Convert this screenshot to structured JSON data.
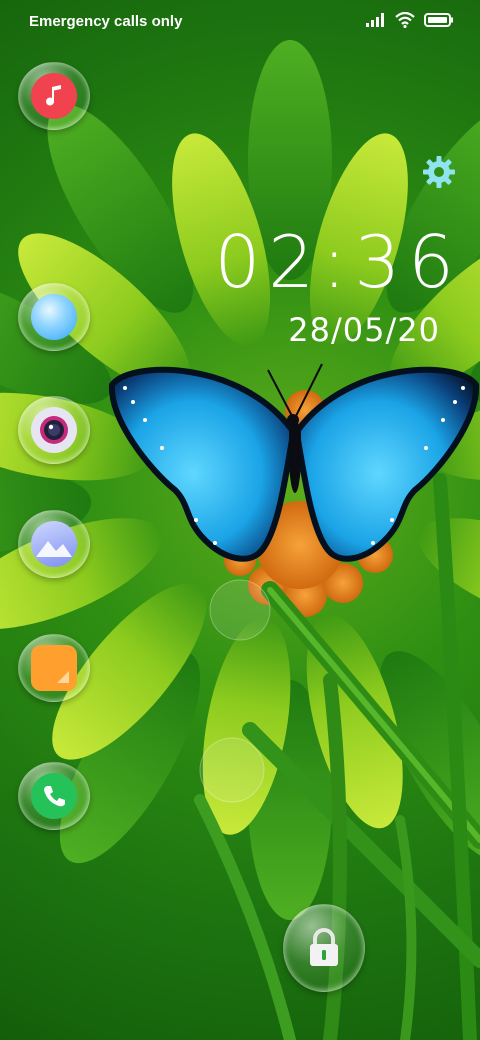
{
  "status_bar": {
    "carrier_text": "Emergency calls only",
    "icons": [
      "signal-icon",
      "wifi-icon",
      "battery-icon"
    ]
  },
  "lockscreen": {
    "time": "02:36",
    "date": "28/05/20",
    "settings_icon": "gear-icon",
    "unlock_icon": "padlock-icon"
  },
  "shortcuts": [
    {
      "name": "music",
      "icon": "music-note-icon",
      "color": "#f0424f"
    },
    {
      "name": "browser",
      "icon": "browser-icon",
      "color": "#2ea6f5"
    },
    {
      "name": "camera",
      "icon": "camera-icon",
      "color": "#d8d8e8"
    },
    {
      "name": "gallery",
      "icon": "gallery-icon",
      "color": "#7c8ff0"
    },
    {
      "name": "notes",
      "icon": "notes-icon",
      "color": "#ff9f2e"
    },
    {
      "name": "phone",
      "icon": "phone-icon",
      "color": "#25c25a"
    }
  ],
  "colors": {
    "background": "#1d7410",
    "petal_light": "#b9e02a",
    "petal_dark": "#3c9a18",
    "butterfly": "#1aa3e6",
    "flower_center": "#e8801c"
  }
}
